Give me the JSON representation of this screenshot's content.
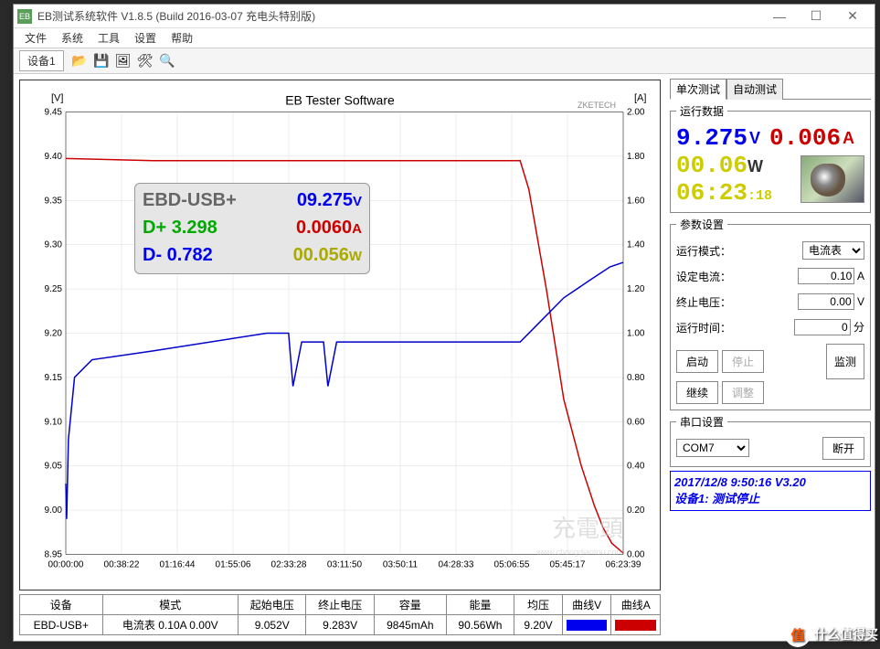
{
  "title": "EB测试系统软件 V1.8.5 (Build 2016-03-07 充电头特别版)",
  "menu": [
    "文件",
    "系统",
    "工具",
    "设置",
    "帮助"
  ],
  "device_tab": "设备1",
  "chart": {
    "title": "EB Tester Software",
    "y_left_label": "[V]",
    "y_right_label": "[A]",
    "watermark": "充電頭",
    "watermark_sub": "www.chongdiantou.com",
    "brand": "ZKETECH"
  },
  "chart_data": {
    "type": "line",
    "xlabel": "",
    "ylabel_left": "V",
    "ylabel_right": "A",
    "x_ticks": [
      "00:00:00",
      "00:38:22",
      "01:16:44",
      "01:55:06",
      "02:33:28",
      "03:11:50",
      "03:50:11",
      "04:28:33",
      "05:06:55",
      "05:45:17",
      "06:23:39"
    ],
    "y_left_ticks": [
      8.95,
      9.0,
      9.05,
      9.1,
      9.15,
      9.2,
      9.25,
      9.3,
      9.35,
      9.4,
      9.45
    ],
    "y_right_ticks": [
      0.0,
      0.2,
      0.4,
      0.6,
      0.8,
      1.0,
      1.2,
      1.4,
      1.6,
      1.8,
      2.0
    ],
    "y_left_range": [
      8.95,
      9.45
    ],
    "y_right_range": [
      0.0,
      2.0
    ],
    "series": [
      {
        "name": "曲线V",
        "axis": "left",
        "color": "#0000cc",
        "x": [
          0,
          0.01,
          0.03,
          0.1,
          0.3,
          1.0,
          2.3,
          2.55,
          2.6,
          2.7,
          2.95,
          3.0,
          3.1,
          4.0,
          5.0,
          5.2,
          5.4,
          5.7,
          6.0,
          6.23,
          6.38
        ],
        "y": [
          9.03,
          8.99,
          9.08,
          9.15,
          9.17,
          9.18,
          9.2,
          9.2,
          9.14,
          9.19,
          9.19,
          9.14,
          9.19,
          9.19,
          9.19,
          9.19,
          9.21,
          9.24,
          9.26,
          9.275,
          9.28
        ]
      },
      {
        "name": "曲线A",
        "axis": "right",
        "color": "#cc0000",
        "x": [
          0,
          1.0,
          2.0,
          3.0,
          4.0,
          5.0,
          5.2,
          5.3,
          5.5,
          5.7,
          5.9,
          6.05,
          6.15,
          6.25,
          6.38
        ],
        "y": [
          1.79,
          1.78,
          1.78,
          1.78,
          1.78,
          1.78,
          1.78,
          1.65,
          1.2,
          0.7,
          0.4,
          0.22,
          0.12,
          0.05,
          0.006
        ]
      }
    ]
  },
  "overlay": {
    "device": "EBD-USB+",
    "voltage": "09.275",
    "v_unit": "V",
    "dplus": "3.298",
    "dminus": "0.782",
    "current": "0.0060",
    "a_unit": "A",
    "power": "00.056",
    "w_unit": "W"
  },
  "table": {
    "headers": [
      "设备",
      "模式",
      "起始电压",
      "终止电压",
      "容量",
      "能量",
      "均压",
      "曲线V",
      "曲线A"
    ],
    "row": {
      "device": "EBD-USB+",
      "mode": "电流表  0.10A  0.00V",
      "start_v": "9.052V",
      "end_v": "9.283V",
      "capacity": "9845mAh",
      "energy": "90.56Wh",
      "avg_v": "9.20V"
    },
    "curve_v_color": "#0000ee",
    "curve_a_color": "#cc0000"
  },
  "side": {
    "tabs": [
      "单次测试",
      "自动测试"
    ],
    "run_data_legend": "运行数据",
    "voltage": "9.275",
    "v_unit": "V",
    "current": "0.006",
    "a_unit": "A",
    "power": "00.06",
    "w_unit": "W",
    "time": "06:23",
    "time_sec": ":18",
    "params_legend": "参数设置",
    "mode_label": "运行模式：",
    "mode_value": "电流表",
    "set_current_label": "设定电流：",
    "set_current": "0.10",
    "set_current_unit": "A",
    "end_voltage_label": "终止电压：",
    "end_voltage": "0.00",
    "end_voltage_unit": "V",
    "run_time_label": "运行时间：",
    "run_time": "0",
    "run_time_unit": "分",
    "btn_start": "启动",
    "btn_stop": "停止",
    "btn_monitor": "监测",
    "btn_continue": "继续",
    "btn_adjust": "调整",
    "serial_legend": "串口设置",
    "com": "COM7",
    "disconnect": "断开",
    "status_line1": "2017/12/8 9:50:16  V3.20",
    "status_line2": "设备1: 测试停止"
  },
  "corner": "什么值得买"
}
